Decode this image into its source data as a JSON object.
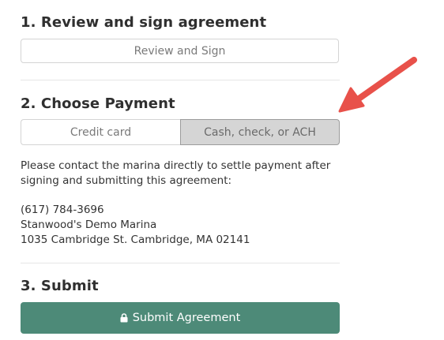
{
  "section1": {
    "title": "1. Review and sign agreement",
    "button_label": "Review and Sign"
  },
  "section2": {
    "title": "2. Choose Payment",
    "options": [
      {
        "label": "Credit card",
        "selected": false
      },
      {
        "label": "Cash, check, or ACH",
        "selected": true
      }
    ],
    "instructions": [
      "Please contact the marina directly to settle payment after",
      "signing and submitting this agreement:"
    ],
    "contact": {
      "phone": "(617) 784-3696",
      "name": "Stanwood's Demo Marina",
      "address": "1035 Cambridge St. Cambridge, MA 02141"
    }
  },
  "section3": {
    "title": "3. Submit",
    "button_label": "Submit Agreement",
    "button_icon": "lock-icon"
  },
  "annotation": {
    "icon": "arrow-icon",
    "color": "#e8514a"
  },
  "colors": {
    "submit_background": "#4d8a78",
    "selected_option_background": "#d5d5d5"
  }
}
